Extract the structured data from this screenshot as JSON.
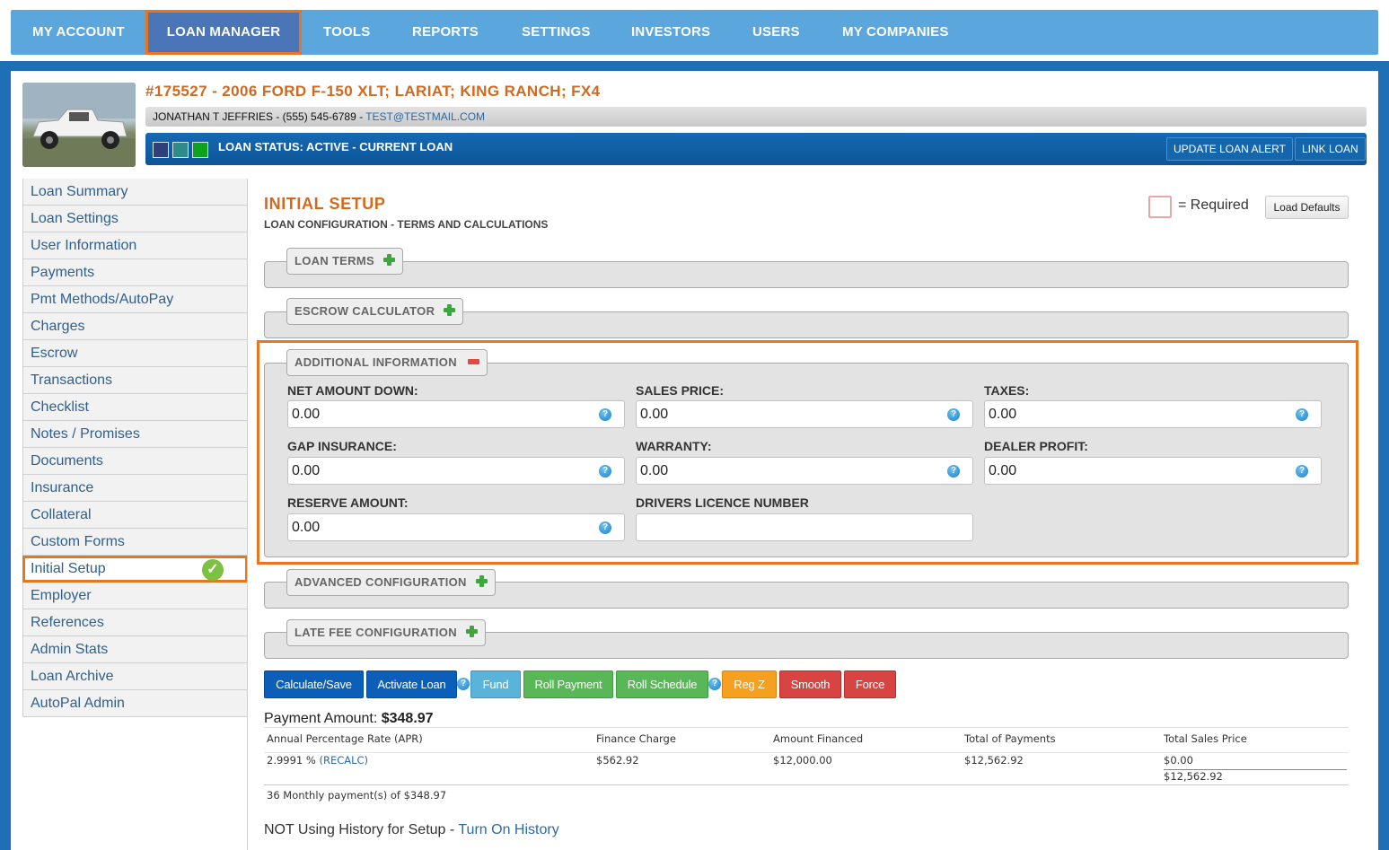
{
  "nav": {
    "items": [
      {
        "label": "MY ACCOUNT"
      },
      {
        "label": "LOAN MANAGER"
      },
      {
        "label": "TOOLS"
      },
      {
        "label": "REPORTS"
      },
      {
        "label": "SETTINGS"
      },
      {
        "label": "INVESTORS"
      },
      {
        "label": "USERS"
      },
      {
        "label": "MY COMPANIES"
      }
    ],
    "active": "LOAN MANAGER"
  },
  "loan": {
    "title": "#175527 - 2006 FORD F-150 XLT; LARIAT; KING RANCH; FX4",
    "contact_text": "JONATHAN T JEFFRIES - (555) 545-6789 - ",
    "email": "TEST@TESTMAIL.COM",
    "status": "LOAN STATUS: ACTIVE - CURRENT LOAN",
    "status_swatches": [
      "#2f3f7a",
      "#2f8a8a",
      "#0ea31e"
    ],
    "update_alert": "UPDATE LOAN ALERT",
    "link_loan": "LINK LOAN"
  },
  "sidebar": {
    "items": [
      {
        "label": "Loan Summary"
      },
      {
        "label": "Loan Settings"
      },
      {
        "label": "User Information"
      },
      {
        "label": "Payments"
      },
      {
        "label": "Pmt Methods/AutoPay"
      },
      {
        "label": "Charges"
      },
      {
        "label": "Escrow"
      },
      {
        "label": "Transactions"
      },
      {
        "label": "Checklist"
      },
      {
        "label": "Notes / Promises"
      },
      {
        "label": "Documents"
      },
      {
        "label": "Insurance"
      },
      {
        "label": "Collateral"
      },
      {
        "label": "Custom Forms"
      },
      {
        "label": "Initial Setup"
      },
      {
        "label": "Employer"
      },
      {
        "label": "References"
      },
      {
        "label": "Admin Stats"
      },
      {
        "label": "Loan Archive"
      },
      {
        "label": "AutoPal Admin"
      }
    ],
    "active": "Initial Setup"
  },
  "main": {
    "title": "INITIAL SETUP",
    "subtitle": "LOAN CONFIGURATION - TERMS AND CALCULATIONS",
    "required_label": "= Required",
    "load_defaults": "Load Defaults",
    "sections": {
      "loan_terms": "LOAN TERMS",
      "escrow": "ESCROW CALCULATOR",
      "additional": "ADDITIONAL INFORMATION",
      "advanced": "ADVANCED CONFIGURATION",
      "late_fee": "LATE FEE CONFIGURATION"
    },
    "fields": {
      "net_amount_down": {
        "label": "NET AMOUNT DOWN:",
        "value": "0.00"
      },
      "sales_price": {
        "label": "SALES PRICE:",
        "value": "0.00"
      },
      "taxes": {
        "label": "TAXES:",
        "value": "0.00"
      },
      "gap_insurance": {
        "label": "GAP INSURANCE:",
        "value": "0.00"
      },
      "warranty": {
        "label": "WARRANTY:",
        "value": "0.00"
      },
      "dealer_profit": {
        "label": "DEALER PROFIT:",
        "value": "0.00"
      },
      "reserve_amount": {
        "label": "RESERVE AMOUNT:",
        "value": "0.00"
      },
      "drivers_licence": {
        "label": "DRIVERS LICENCE NUMBER",
        "value": ""
      }
    },
    "buttons": {
      "calculate": "Calculate/Save",
      "activate": "Activate Loan",
      "fund": "Fund",
      "roll_payment": "Roll Payment",
      "roll_schedule": "Roll Schedule",
      "regz": "Reg Z",
      "smooth": "Smooth",
      "force": "Force"
    },
    "payment_label": "Payment Amount: ",
    "payment_amount": "$348.97",
    "tila": {
      "headers": [
        "Annual Percentage Rate (APR)",
        "Finance Charge",
        "Amount Financed",
        "Total of Payments",
        "Total Sales Price"
      ],
      "apr": "2.9991 % ",
      "recalc": "(RECALC)",
      "finance_charge": "$562.92",
      "amount_financed": "$12,000.00",
      "total_payments": "$12,562.92",
      "sales_price_line1": "$0.00",
      "sales_price_line2": "$12,562.92",
      "footer": "36 Monthly payment(s) of $348.97"
    },
    "history_text": "NOT Using History for Setup - ",
    "history_link": "Turn On History"
  }
}
